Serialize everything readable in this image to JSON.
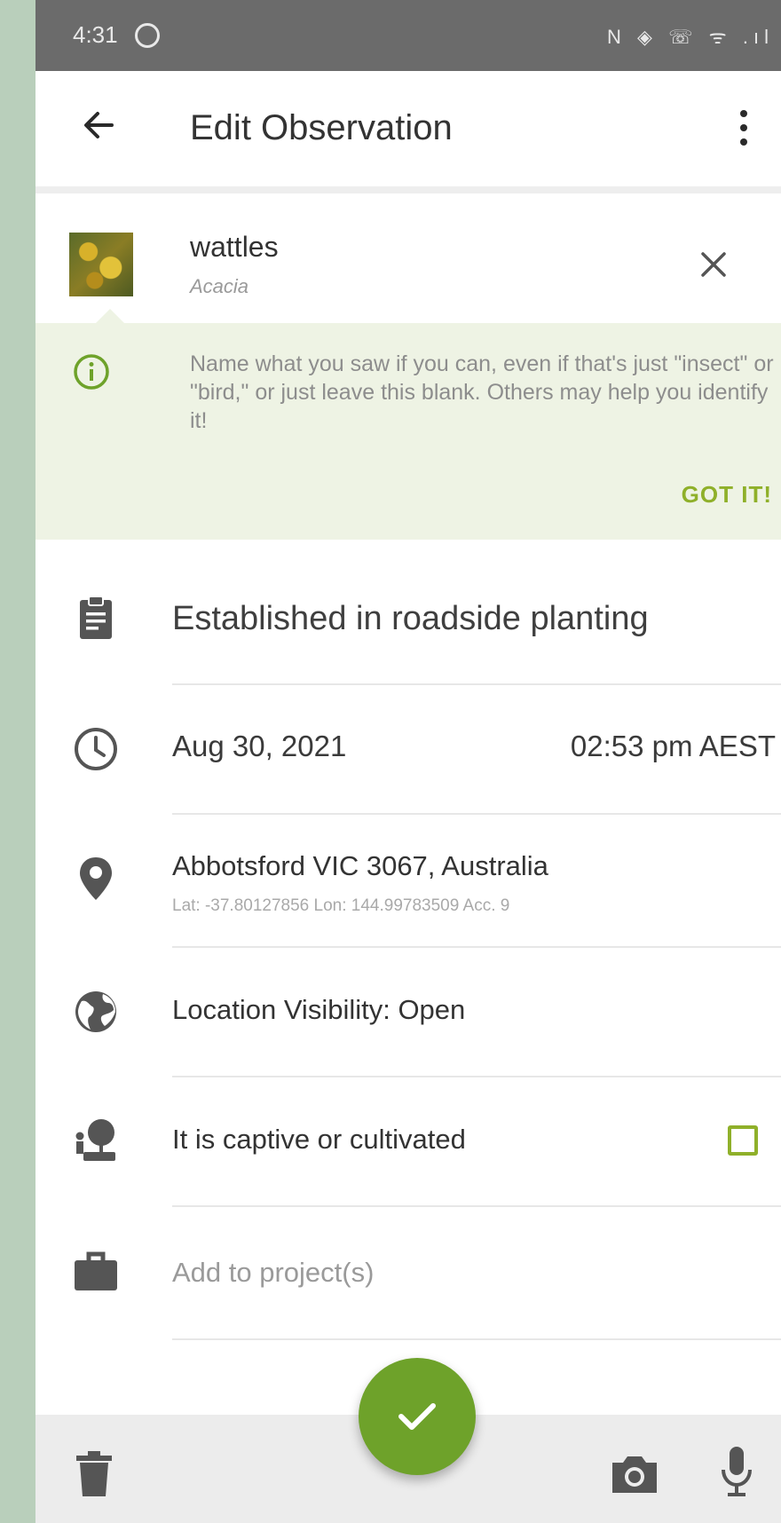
{
  "status_bar": {
    "time": "4:31",
    "icons_text": "N ◈ ☏ ᯤ .ıl"
  },
  "app_bar": {
    "title": "Edit Observation"
  },
  "taxon": {
    "common_name": "wattles",
    "scientific_name": "Acacia"
  },
  "tip": {
    "message": "Name what you saw if you can, even if that's just \"insect\" or \"bird,\" or just leave this blank. Others may help you identify it!",
    "dismiss_label": "GOT IT!"
  },
  "description": {
    "text": "Established in roadside planting"
  },
  "datetime": {
    "date": "Aug 30, 2021",
    "time": "02:53 pm AEST"
  },
  "location": {
    "place": "Abbotsford VIC 3067, Australia",
    "coords": "Lat: -37.80127856 Lon: 144.99783509 Acc. 9"
  },
  "visibility": {
    "label": "Location Visibility: Open"
  },
  "captive": {
    "label": "It is captive or cultivated",
    "checked": false
  },
  "projects": {
    "placeholder": "Add to project(s)"
  },
  "colors": {
    "accent": "#6ea22a",
    "tip_bg": "#eef3e4",
    "got_it": "#8fb02a"
  }
}
